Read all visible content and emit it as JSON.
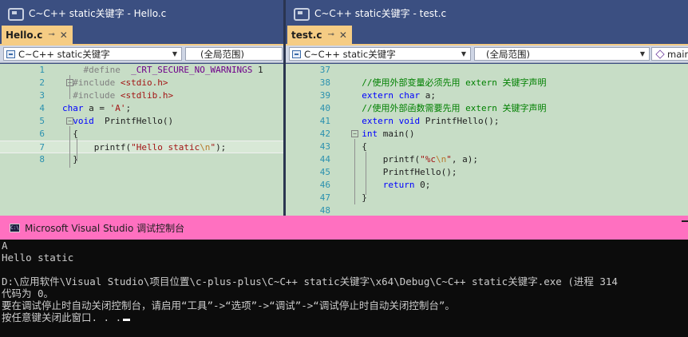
{
  "left_window": {
    "title": "C~C++ static关键字 - Hello.c",
    "tab": {
      "label": "Hello.c",
      "pin": "⊸",
      "close": "✕"
    },
    "nav": {
      "project": "C~C++ static关键字",
      "scope": "(全局范围)"
    },
    "lines": [
      {
        "n": "1",
        "html": "    <span class=\"pp\">#define</span>  <span class=\"mac\">_CRT_SECURE_NO_WARNINGS</span> 1"
      },
      {
        "n": "2",
        "html": "  <span class=\"pp\">#include</span> <span class=\"ppinc\">&lt;stdio.h&gt;</span>"
      },
      {
        "n": "3",
        "html": "  <span class=\"pp\">#include</span> <span class=\"ppinc\">&lt;stdlib.h&gt;</span>"
      },
      {
        "n": "4",
        "html": "<span class=\"kw\">char</span> a = <span class=\"str\">'A'</span>;"
      },
      {
        "n": "5",
        "html": "  <span class=\"kw\">void</span>  PrintfHello()"
      },
      {
        "n": "6",
        "html": "  {"
      },
      {
        "n": "7",
        "html": "      printf(<span class=\"str\">\"Hello static</span><span class=\"esc\">\\n</span><span class=\"str\">\"</span>);"
      },
      {
        "n": "8",
        "html": "  }"
      }
    ]
  },
  "right_window": {
    "title": "C~C++ static关键字 - test.c",
    "tab": {
      "label": "test.c",
      "pin": "⊸",
      "close": "✕"
    },
    "nav": {
      "project": "C~C++ static关键字",
      "scope": "(全局范围)",
      "member": "mair"
    },
    "lines": [
      {
        "n": "37",
        "html": ""
      },
      {
        "n": "38",
        "html": "  <span class=\"cmt\">//使用外部变量必须先用 extern 关键字声明</span>"
      },
      {
        "n": "39",
        "html": "  <span class=\"kw\">extern</span> <span class=\"kw\">char</span> a;"
      },
      {
        "n": "40",
        "html": "  <span class=\"cmt\">//使用外部函数需要先用 extern 关键字声明</span>"
      },
      {
        "n": "41",
        "html": "  <span class=\"kw\">extern</span> <span class=\"kw\">void</span> PrintfHello();"
      },
      {
        "n": "42",
        "html": "  <span class=\"kw\">int</span> main()"
      },
      {
        "n": "43",
        "html": "  {"
      },
      {
        "n": "44",
        "html": "      printf(<span class=\"str\">\"%c</span><span class=\"esc\">\\n</span><span class=\"str\">\"</span>, a);"
      },
      {
        "n": "45",
        "html": "      PrintfHello();"
      },
      {
        "n": "46",
        "html": "      <span class=\"kw\">return</span> 0;"
      },
      {
        "n": "47",
        "html": "  }"
      },
      {
        "n": "48",
        "html": ""
      }
    ]
  },
  "console": {
    "title": "Microsoft Visual Studio 调试控制台",
    "lines": [
      "A",
      "Hello static",
      "",
      "D:\\应用软件\\Visual Studio\\项目位置\\c-plus-plus\\C~C++ static关键字\\x64\\Debug\\C~C++ static关键字.exe (进程 314",
      "代码为 0。",
      "要在调试停止时自动关闭控制台，请启用“工具”->“选项”->“调试”->“调试停止时自动关闭控制台”。",
      "按任意键关闭此窗口. . ."
    ]
  }
}
